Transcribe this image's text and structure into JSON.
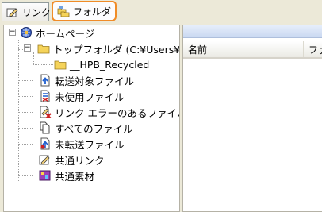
{
  "tabs": [
    {
      "label": "リンク",
      "icon": "link-pencil-icon",
      "selected": false
    },
    {
      "label": "フォルダ",
      "icon": "folders-icon",
      "selected": true
    }
  ],
  "tree": {
    "root": {
      "label": "ホームページ",
      "icon": "homepage-globe-icon",
      "expanded": true
    },
    "top_folder": {
      "label": "トップフォルダ (C:¥Users¥",
      "icon": "folder-icon",
      "expanded": true
    },
    "recycled": {
      "label": "__HPB_Recycled",
      "icon": "folder-icon"
    },
    "items": [
      {
        "label": "転送対象ファイル",
        "icon": "transfer-target-file-icon"
      },
      {
        "label": "未使用ファイル",
        "icon": "unused-file-icon"
      },
      {
        "label": "リンク エラーのあるファイル",
        "icon": "link-error-file-icon"
      },
      {
        "label": "すべてのファイル",
        "icon": "all-files-icon"
      },
      {
        "label": "未転送ファイル",
        "icon": "untransferred-file-icon"
      },
      {
        "label": "共通リンク",
        "icon": "common-link-icon"
      },
      {
        "label": "共通素材",
        "icon": "common-material-icon"
      }
    ]
  },
  "list": {
    "columns": [
      "名前",
      "ファ"
    ]
  },
  "colors": {
    "selected_tab_border": "#f08c28",
    "folder_yellow": "#f5d35a",
    "panel_border": "#b5b2a6"
  }
}
